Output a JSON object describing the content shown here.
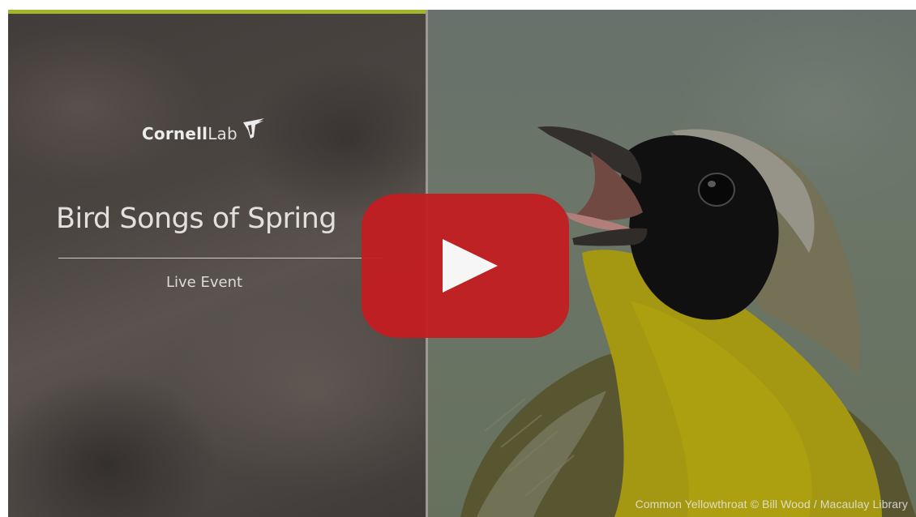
{
  "video": {
    "logo_bold": "Cornell",
    "logo_light": "Lab",
    "title": "Bird Songs of Spring",
    "subtitle": "Live Event",
    "photo_credit": "Common Yellowthroat © Bill Wood / Macaulay Library"
  },
  "icons": {
    "logo_mark": "bird-logo-icon",
    "play": "play-icon"
  },
  "colors": {
    "accent_bar": "#a3b62a",
    "play_button": "#c41d21",
    "left_panel": "#4a4441"
  }
}
